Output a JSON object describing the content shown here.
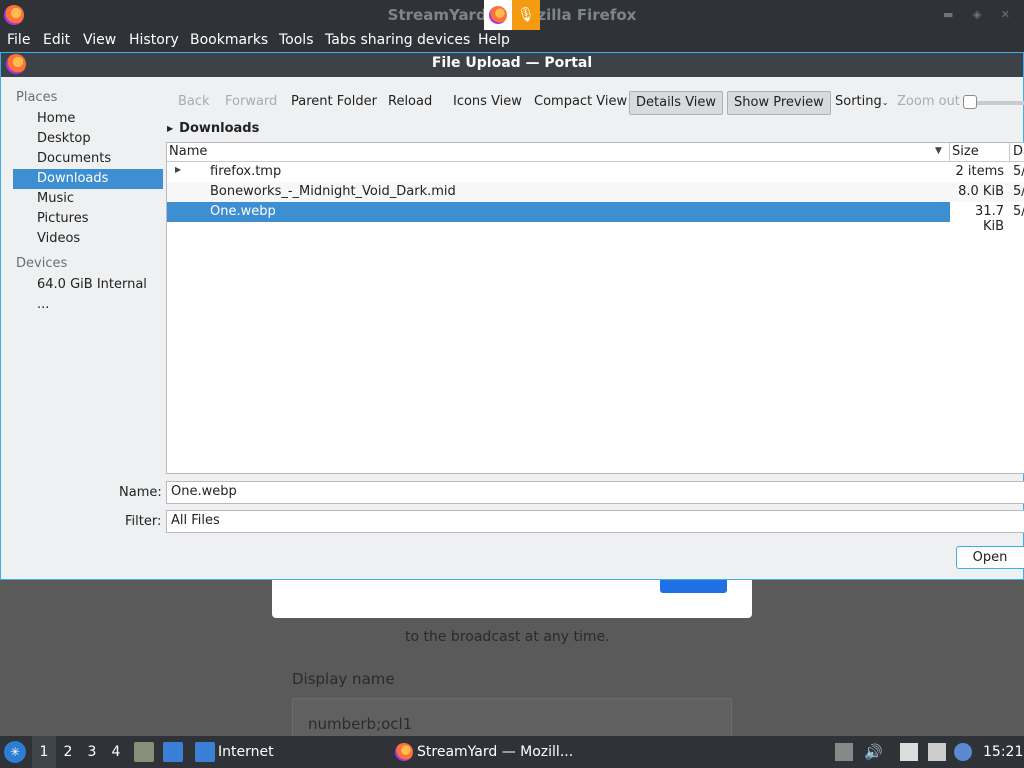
{
  "firefox": {
    "window_title": "StreamYard — Mozilla Firefox",
    "menu": [
      "File",
      "Edit",
      "View",
      "History",
      "Bookmarks",
      "Tools",
      "Tabs sharing devices",
      "Help"
    ]
  },
  "dialog": {
    "title": "File Upload — Portal",
    "places": {
      "section_places": "Places",
      "items": [
        "Home",
        "Desktop",
        "Documents",
        "Downloads",
        "Music",
        "Pictures",
        "Videos"
      ],
      "selected": "Downloads",
      "section_devices": "Devices",
      "devices": [
        "64.0 GiB Internal ..."
      ]
    },
    "toolbar": {
      "back": "Back",
      "forward": "Forward",
      "parent_folder": "Parent Folder",
      "reload": "Reload",
      "icons_view": "Icons View",
      "compact_view": "Compact View",
      "details_view": "Details View",
      "show_preview": "Show Preview",
      "sorting": "Sorting",
      "zoom_out": "Zoom out"
    },
    "breadcrumb": "Downloads",
    "columns": {
      "name": "Name",
      "size": "Size",
      "date": "Da"
    },
    "files": [
      {
        "name": "firefox.tmp",
        "size": "2 items",
        "date": "5/",
        "folder": true
      },
      {
        "name": "Boneworks_-_Midnight_Void_Dark.mid",
        "size": "8.0 KiB",
        "date": "5/"
      },
      {
        "name": "One.webp",
        "size": "31.7 KiB",
        "date": "5/",
        "selected": true
      }
    ],
    "name_label": "Name:",
    "name_value": "One.webp",
    "filter_label": "Filter:",
    "filter_value": "All Files",
    "open_button": "Open"
  },
  "background_page": {
    "text": "to the broadcast at any time.",
    "display_name_label": "Display name",
    "display_name_value": "numberb;ocl1"
  },
  "taskbar": {
    "workspaces": [
      "1",
      "2",
      "3",
      "4"
    ],
    "internet_label": "Internet",
    "window_label": "StreamYard — Mozill...",
    "clock": "15:21"
  }
}
